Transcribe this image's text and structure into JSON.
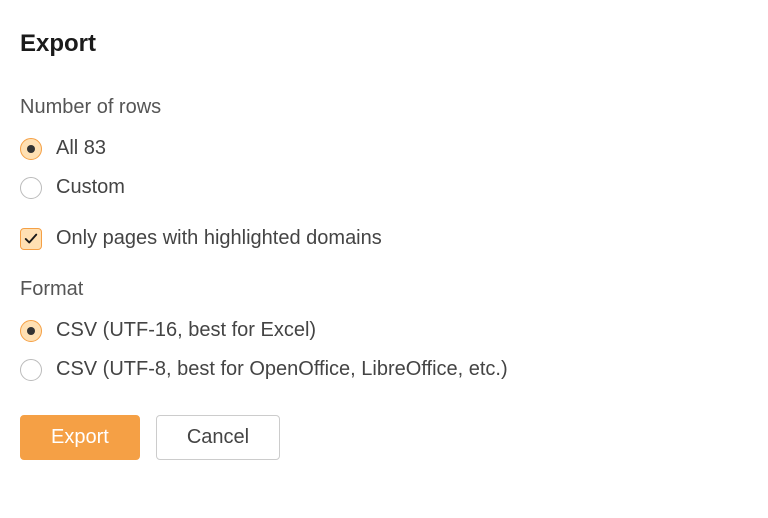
{
  "title": "Export",
  "rows": {
    "label": "Number of rows",
    "options": {
      "all": "All 83",
      "custom": "Custom"
    },
    "highlighted_checkbox": "Only pages with highlighted domains"
  },
  "format": {
    "label": "Format",
    "options": {
      "utf16": "CSV (UTF-16, best for Excel)",
      "utf8": "CSV (UTF-8, best for OpenOffice, LibreOffice, etc.)"
    }
  },
  "buttons": {
    "export": "Export",
    "cancel": "Cancel"
  }
}
